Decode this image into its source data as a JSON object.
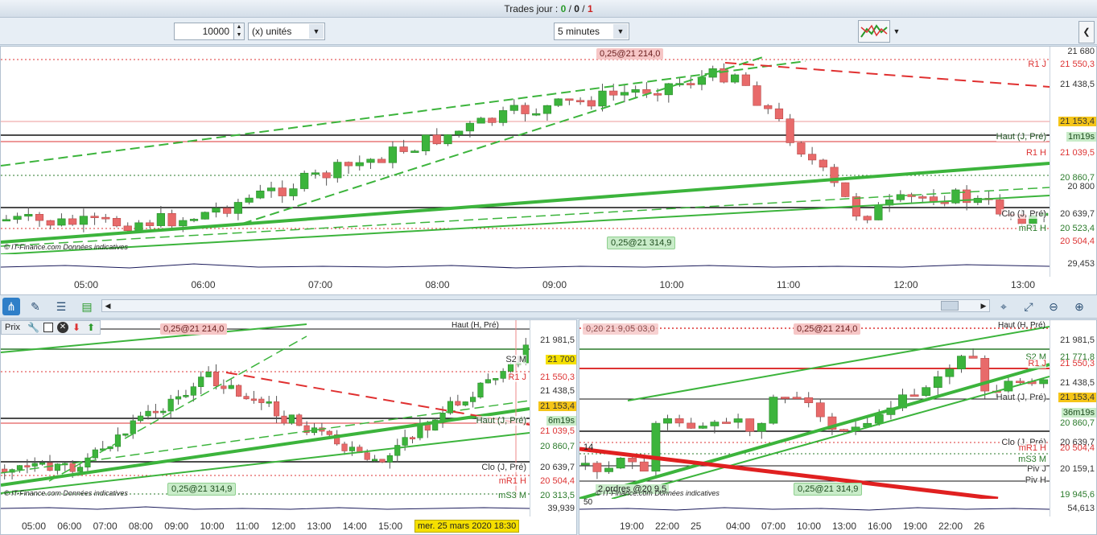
{
  "title": {
    "prefix": "Trades jour : ",
    "a": "0",
    "sep1": " / ",
    "b": "0",
    "sep2": " / ",
    "c": "1"
  },
  "toolbar": {
    "quantity": "10000",
    "unit_select": "(x) unités",
    "interval_select": "5 minutes"
  },
  "top_chart": {
    "tag_top": "0,25@21 214,0",
    "tag_bottom": "0,25@21 314,9",
    "watermark": "© IT-Finance.com  Données indicatives",
    "levels": [
      {
        "label": "R1 J",
        "price": "21 550,3",
        "color": "#d33"
      },
      {
        "label": "",
        "price": "21 438,5",
        "color": "#333"
      },
      {
        "label": "",
        "price": "21 153,4",
        "color": "#333",
        "bg": "#f5c518"
      },
      {
        "label": "Haut (J, Pré)",
        "price": "1m19s",
        "color": "#1e4d1e",
        "bg": "#c9ecc9"
      },
      {
        "label": "R1 H",
        "price": "21 039,5",
        "color": "#d33"
      },
      {
        "label": "",
        "price": "20 860,7",
        "color": "#2a7a2a"
      },
      {
        "label": "",
        "price": "20 800",
        "color": "#333"
      },
      {
        "label": "Clo (J, Pré)",
        "price": "20 639,7",
        "color": "#333"
      },
      {
        "label": "mR1 H",
        "price": "20 523,4",
        "color": "#2a7a2a"
      },
      {
        "label": "",
        "price": "20 504,4",
        "color": "#d33"
      }
    ],
    "top_price_cut": "21 680",
    "oscillator_value": "29,453",
    "time_labels": [
      "05:00",
      "06:00",
      "07:00",
      "08:00",
      "09:00",
      "10:00",
      "11:00",
      "12:00",
      "13:00"
    ]
  },
  "bottom_left": {
    "header_label": "Prix",
    "tag_top": "0,25@21 214,0",
    "tag_bottom": "0,25@21 314,9",
    "watermark": "© IT-Finance.com  Données indicatives",
    "haut_label": "Haut (H, Pré)",
    "levels": [
      {
        "label": "",
        "price": "21 981,5",
        "color": "#333"
      },
      {
        "label": "S2 M",
        "price": "21 700",
        "color": "#333",
        "bg": "#f5e000"
      },
      {
        "label": "R1 J",
        "price": "21 550,3",
        "color": "#d33"
      },
      {
        "label": "",
        "price": "21 438,5",
        "color": "#333"
      },
      {
        "label": "",
        "price": "21 153,4",
        "color": "#333",
        "bg": "#f5c518"
      },
      {
        "label": "Haut (J, Pré)",
        "price": "6m19s",
        "color": "#1e4d1e",
        "bg": "#c9ecc9"
      },
      {
        "label": "",
        "price": "21 039,5",
        "color": "#d33"
      },
      {
        "label": "",
        "price": "20 860,7",
        "color": "#2a7a2a"
      },
      {
        "label": "Clo (J, Pré)",
        "price": "20 639,7",
        "color": "#333"
      },
      {
        "label": "mR1 H",
        "price": "20 504,4",
        "color": "#d33"
      },
      {
        "label": "mS3 M",
        "price": "20 313,5",
        "color": "#2a7a2a"
      }
    ],
    "oscillator_value": "39,939",
    "time_labels": [
      "05:00",
      "06:00",
      "07:00",
      "08:00",
      "09:00",
      "10:00",
      "11:00",
      "12:00",
      "13:00",
      "14:00",
      "15:00"
    ],
    "date_badge": "mer. 25 mars 2020 18:30"
  },
  "bottom_right": {
    "tag_top": "0,25@21 214,0",
    "tag_top_left": "0,20 21 9,05 03,0",
    "tag_bottom": "0,25@21 314,9",
    "tag_bottom_left": "2 ordres @20 9,5",
    "watermark": "© IT-Finance.com  Données indicatives",
    "haut_label": "Haut (H, Pré)",
    "levels": [
      {
        "label": "",
        "price": "21 981,5",
        "color": "#333"
      },
      {
        "label": "S2 M",
        "price": "21 771,8",
        "color": "#2a7a2a"
      },
      {
        "label": "R1 J",
        "price": "21 550,3",
        "color": "#d33"
      },
      {
        "label": "",
        "price": "21 438,5",
        "color": "#333"
      },
      {
        "label": "Haut (J, Pré)",
        "price": "21 153,4",
        "color": "#333",
        "bg": "#f5c518"
      },
      {
        "label": "",
        "price": "36m19s",
        "color": "#1e4d1e",
        "bg": "#c9ecc9"
      },
      {
        "label": "",
        "price": "20 860,7",
        "color": "#2a7a2a"
      },
      {
        "label": "Clo (J, Pré)",
        "price": "20 639,7",
        "color": "#333"
      },
      {
        "label": "mR1 H",
        "price": "20 504,4",
        "color": "#d33"
      },
      {
        "label": "mS3 M",
        "price": "",
        "color": "#2a7a2a"
      },
      {
        "label": "Piv J",
        "price": "20 159,1",
        "color": "#333"
      },
      {
        "label": "Piv H",
        "price": "",
        "color": "#333"
      },
      {
        "label": "",
        "price": "19 945,6",
        "color": "#2a7a2a"
      }
    ],
    "left_value": "14",
    "oscillator_value": "54,613",
    "oscillator_left": "50",
    "time_labels": [
      "19:00",
      "22:00",
      "25",
      "04:00",
      "07:00",
      "10:00",
      "13:00",
      "16:00",
      "19:00",
      "22:00",
      "26"
    ]
  },
  "colors": {
    "bull": "#3cb43c",
    "bear": "#e86a6a",
    "accent": "#f5c518"
  }
}
